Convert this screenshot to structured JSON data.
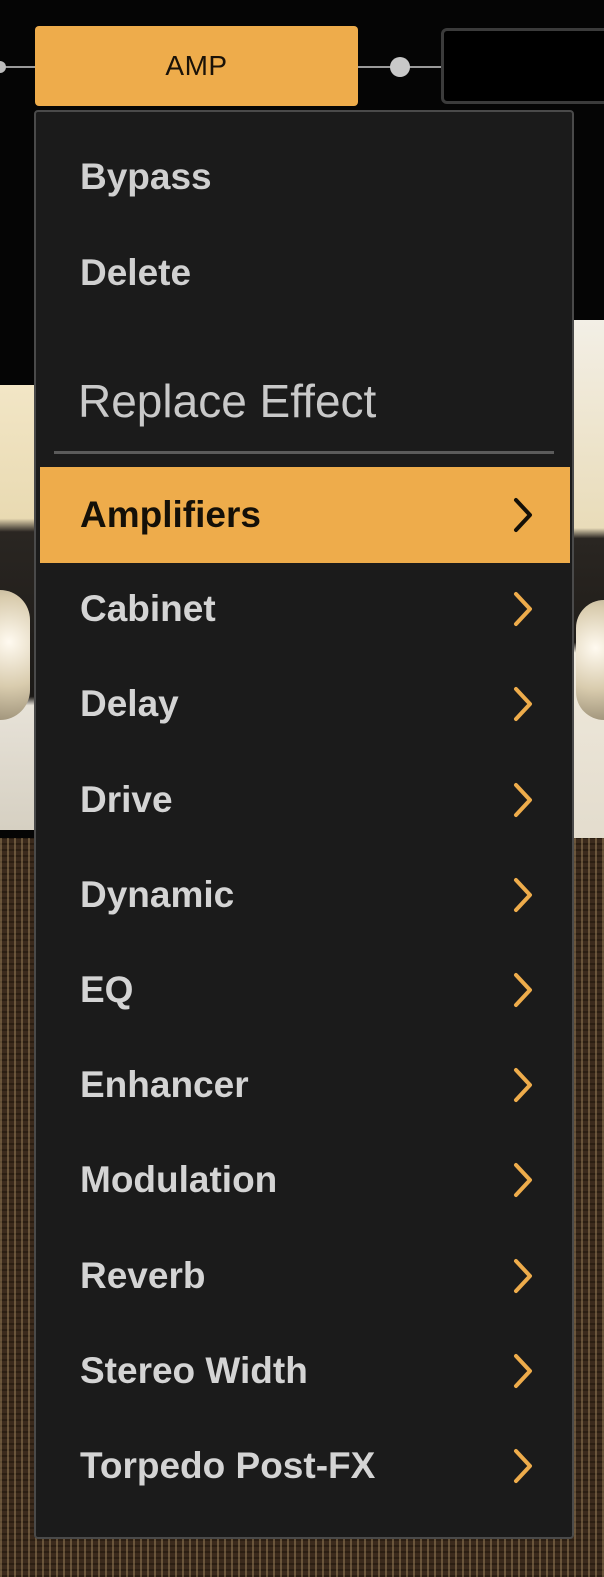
{
  "signal_chain": {
    "amp_block_label": "AMP"
  },
  "menu": {
    "actions": [
      "Bypass",
      "Delete"
    ],
    "section_heading": "Replace Effect",
    "categories": [
      {
        "label": "Amplifiers",
        "selected": true
      },
      {
        "label": "Cabinet",
        "selected": false
      },
      {
        "label": "Delay",
        "selected": false
      },
      {
        "label": "Drive",
        "selected": false
      },
      {
        "label": "Dynamic",
        "selected": false
      },
      {
        "label": "EQ",
        "selected": false
      },
      {
        "label": "Enhancer",
        "selected": false
      },
      {
        "label": "Modulation",
        "selected": false
      },
      {
        "label": "Reverb",
        "selected": false
      },
      {
        "label": "Stereo Width",
        "selected": false
      },
      {
        "label": "Torpedo Post-FX",
        "selected": false
      }
    ],
    "submenu_indicator_icon": "chevron-right-icon"
  },
  "colors": {
    "accent": "#eeac4b",
    "menu_bg": "#1b1b1b",
    "menu_text": "#d4d4d4"
  }
}
